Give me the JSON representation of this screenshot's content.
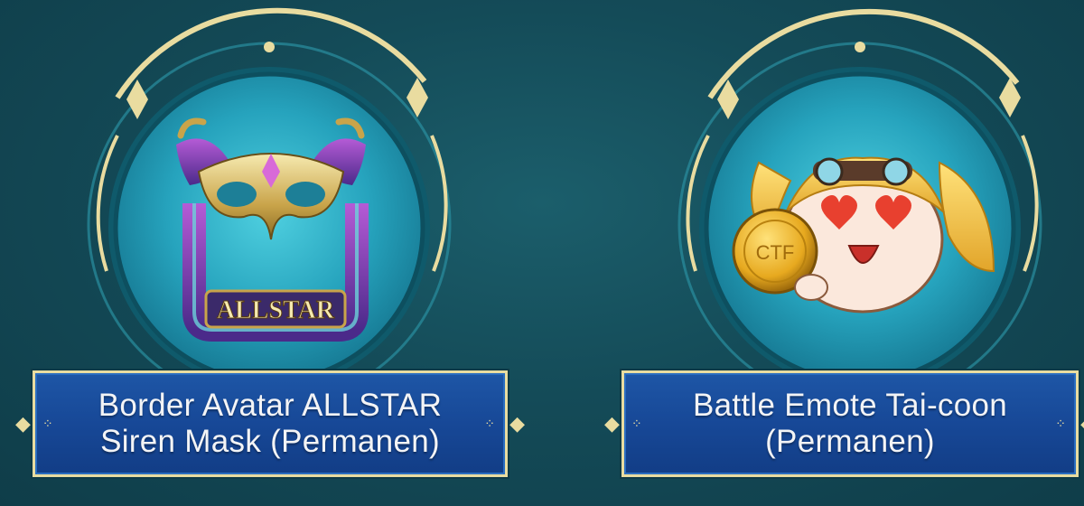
{
  "rewards": [
    {
      "id": "border-avatar",
      "item_text": "ALLSTAR",
      "title_line1": "Border Avatar ALLSTAR",
      "title_line2": "Siren Mask (Permanen)"
    },
    {
      "id": "battle-emote",
      "item_text": "CTF",
      "title_line1": "Battle Emote Tai-coon",
      "title_line2": "(Permanen)"
    }
  ],
  "colors": {
    "background": "#144b58",
    "ring_gold": "#e9dca0",
    "orb_cyan": "#2fb3c9",
    "plate_blue": "#1a4f9e",
    "text_light": "#f3f4f6"
  }
}
